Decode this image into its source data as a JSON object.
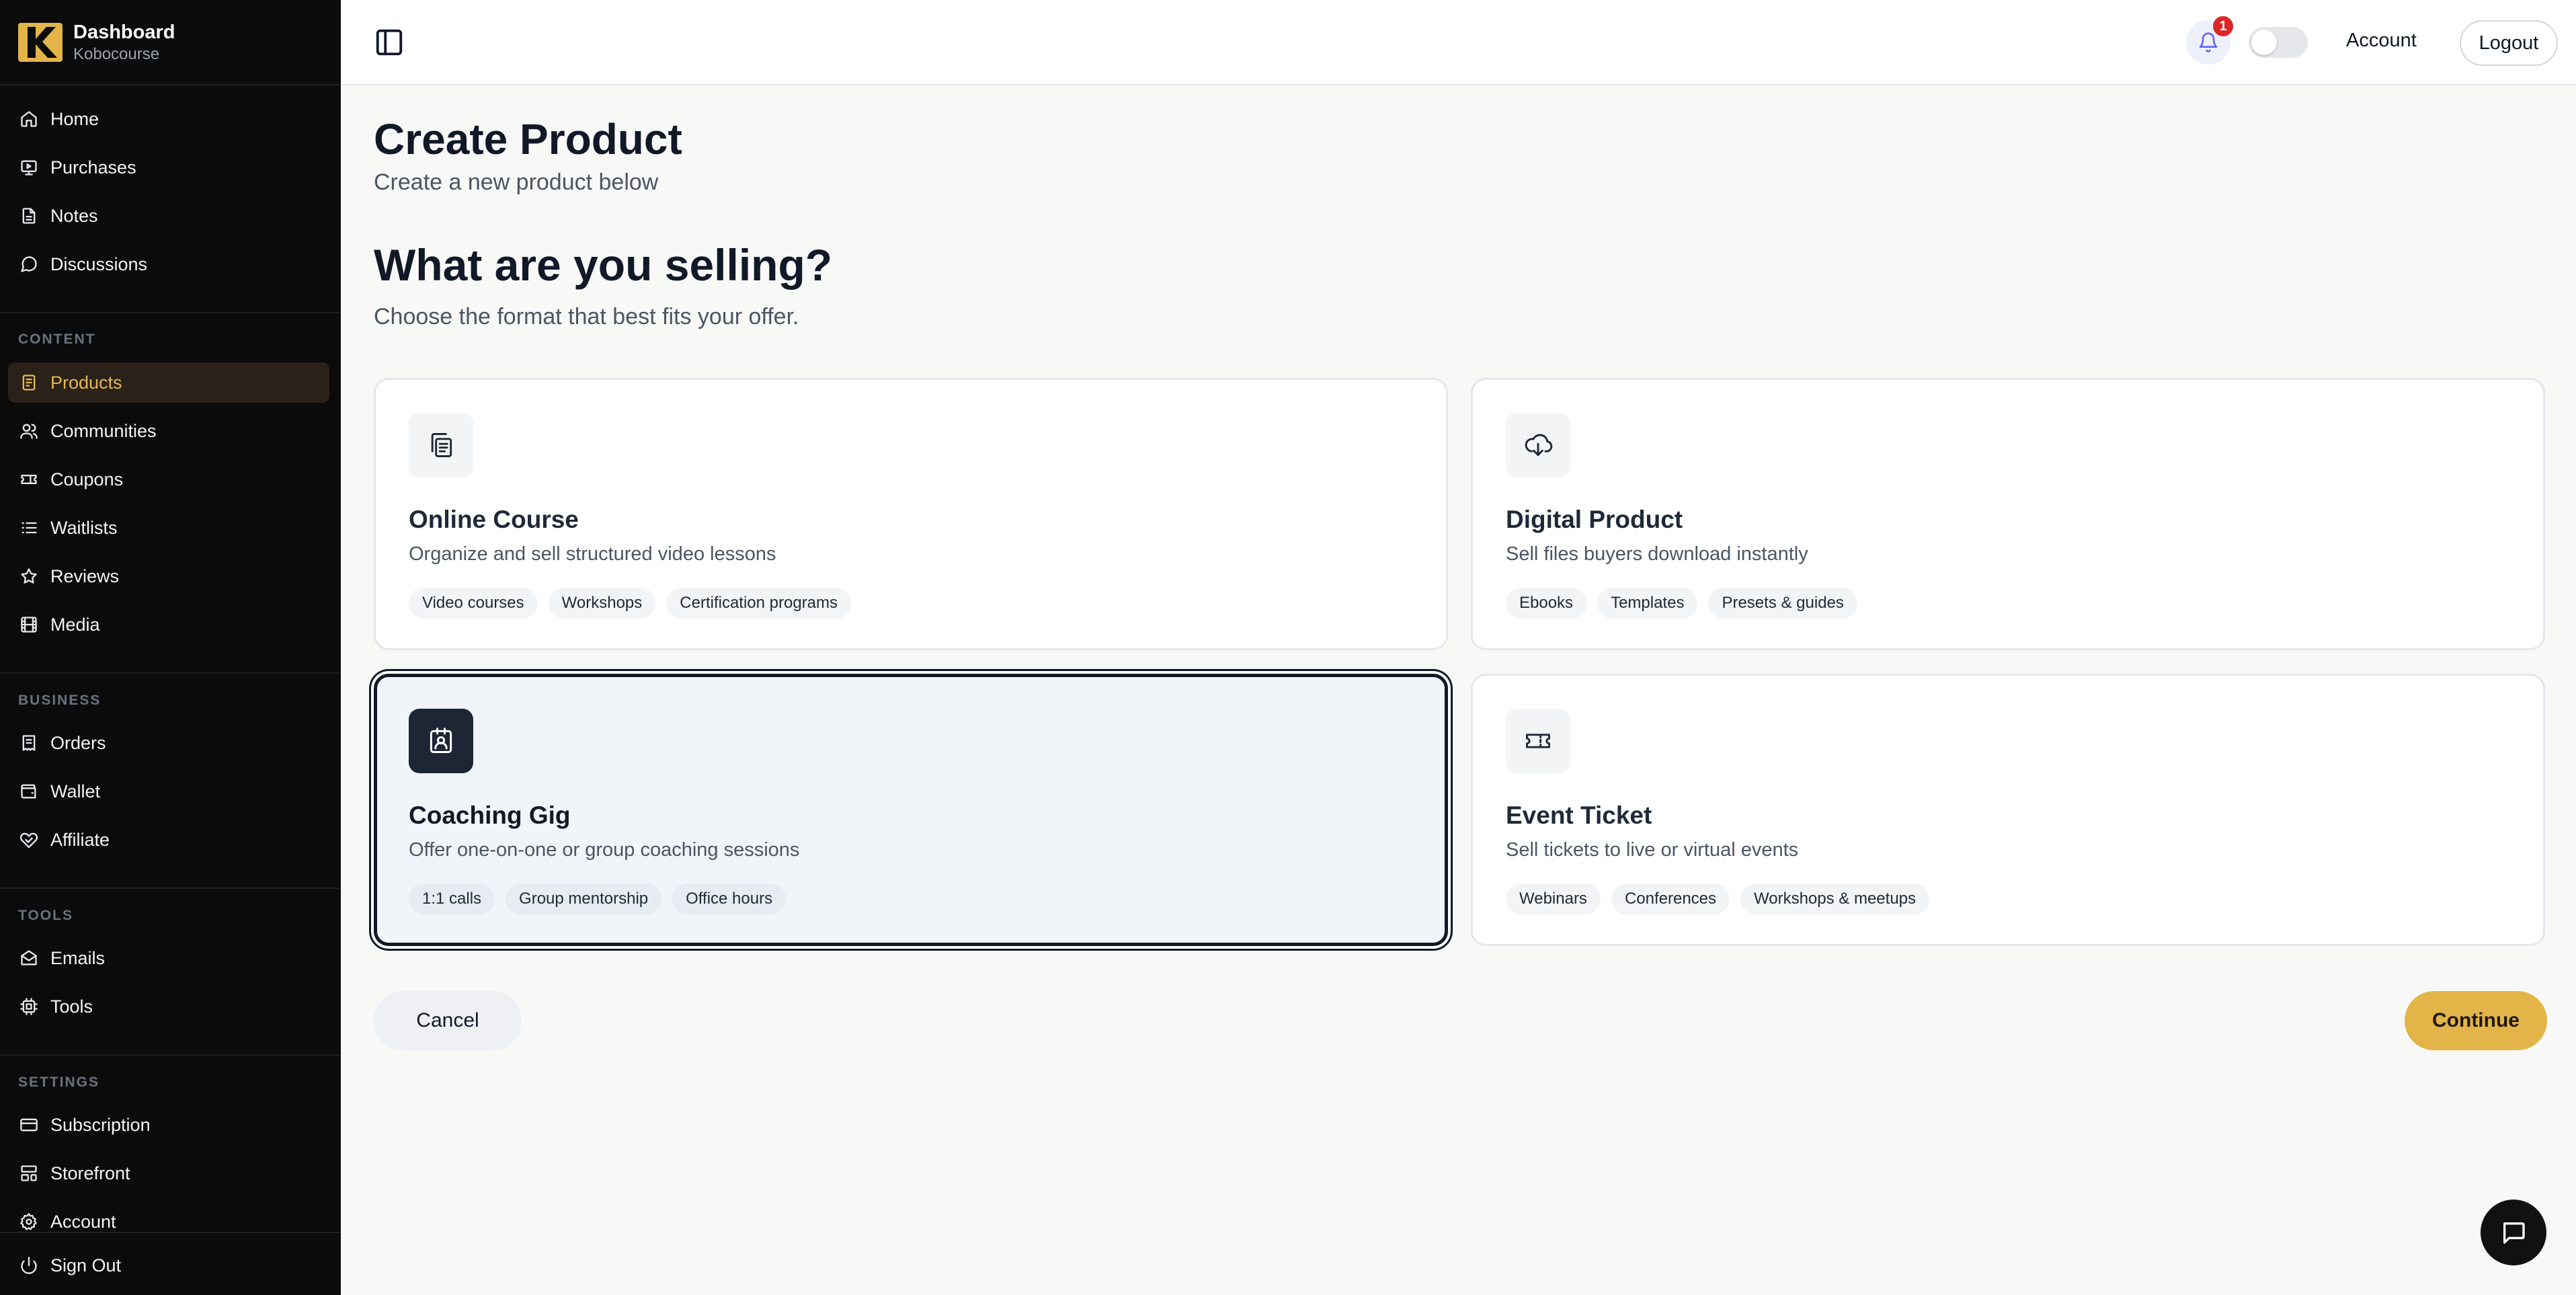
{
  "brand": {
    "title": "Dashboard",
    "subtitle": "Kobocourse"
  },
  "sidebar": {
    "main_items": [
      {
        "label": "Home",
        "icon": "home-icon"
      },
      {
        "label": "Purchases",
        "icon": "purchases-icon"
      },
      {
        "label": "Notes",
        "icon": "notes-icon"
      },
      {
        "label": "Discussions",
        "icon": "discussions-icon"
      }
    ],
    "content_label": "CONTENT",
    "content_items": [
      {
        "label": "Products",
        "icon": "products-icon",
        "active": true
      },
      {
        "label": "Communities",
        "icon": "communities-icon"
      },
      {
        "label": "Coupons",
        "icon": "coupons-icon"
      },
      {
        "label": "Waitlists",
        "icon": "waitlists-icon"
      },
      {
        "label": "Reviews",
        "icon": "star-icon"
      },
      {
        "label": "Media",
        "icon": "media-icon"
      }
    ],
    "business_label": "BUSINESS",
    "business_items": [
      {
        "label": "Orders",
        "icon": "orders-icon"
      },
      {
        "label": "Wallet",
        "icon": "wallet-icon"
      },
      {
        "label": "Affiliate",
        "icon": "affiliate-icon"
      }
    ],
    "tools_label": "TOOLS",
    "tools_items": [
      {
        "label": "Emails",
        "icon": "email-icon"
      },
      {
        "label": "Tools",
        "icon": "tools-icon"
      }
    ],
    "settings_label": "SETTINGS",
    "settings_items": [
      {
        "label": "Subscription",
        "icon": "subscription-icon"
      },
      {
        "label": "Storefront",
        "icon": "storefront-icon"
      },
      {
        "label": "Account",
        "icon": "gear-icon"
      }
    ],
    "sign_out": {
      "label": "Sign Out",
      "icon": "power-icon"
    }
  },
  "topbar": {
    "notification_count": "1",
    "account_label": "Account",
    "logout_label": "Logout"
  },
  "page": {
    "title": "Create Product",
    "subtitle": "Create a new product below",
    "section_title": "What are you selling?",
    "section_subtitle": "Choose the format that best fits your offer."
  },
  "products": [
    {
      "title": "Online Course",
      "description": "Organize and sell structured video lessons",
      "icon": "course-icon",
      "tags": [
        "Video courses",
        "Workshops",
        "Certification programs"
      ],
      "selected": false
    },
    {
      "title": "Digital Product",
      "description": "Sell files buyers download instantly",
      "icon": "download-cloud-icon",
      "tags": [
        "Ebooks",
        "Templates",
        "Presets & guides"
      ],
      "selected": false
    },
    {
      "title": "Coaching Gig",
      "description": "Offer one-on-one or group coaching sessions",
      "icon": "coaching-icon",
      "tags": [
        "1:1 calls",
        "Group mentorship",
        "Office hours"
      ],
      "selected": true
    },
    {
      "title": "Event Ticket",
      "description": "Sell tickets to live or virtual events",
      "icon": "ticket-icon",
      "tags": [
        "Webinars",
        "Conferences",
        "Workshops & meetups"
      ],
      "selected": false
    }
  ],
  "actions": {
    "cancel_label": "Cancel",
    "continue_label": "Continue"
  },
  "colors": {
    "accent": "#e3b448",
    "sidebar_bg": "#0b0b0b",
    "active_text": "#e5b84e",
    "badge": "#dc2626"
  }
}
